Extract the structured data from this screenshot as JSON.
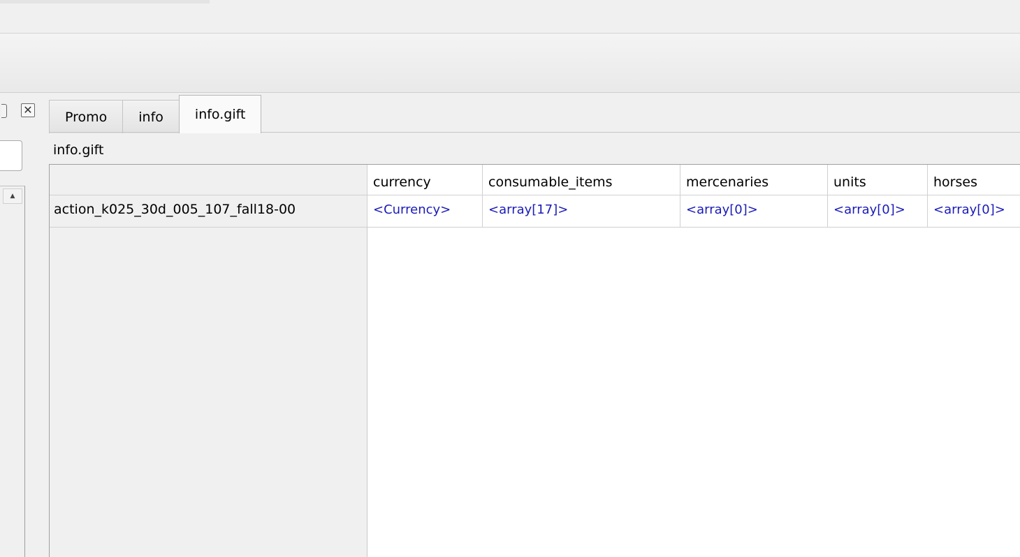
{
  "tabs": [
    {
      "label": "Promo"
    },
    {
      "label": "info"
    },
    {
      "label": "info.gift"
    }
  ],
  "active_tab": "info.gift",
  "pane_title": "info.gift",
  "table": {
    "columns": [
      "currency",
      "consumable_items",
      "mercenaries",
      "units",
      "horses"
    ],
    "rows": [
      {
        "name": "action_k025_30d_005_107_fall18-00",
        "cells": [
          "<Currency>",
          "<array[17]>",
          "<array[0]>",
          "<array[0]>",
          "<array[0]>"
        ]
      }
    ]
  },
  "icons": {
    "close": "close-icon",
    "float": "float-icon",
    "scroll_up": "scroll-up-icon"
  },
  "colors": {
    "link_value": "#1a1ab8",
    "background": "#f0f0f0"
  }
}
